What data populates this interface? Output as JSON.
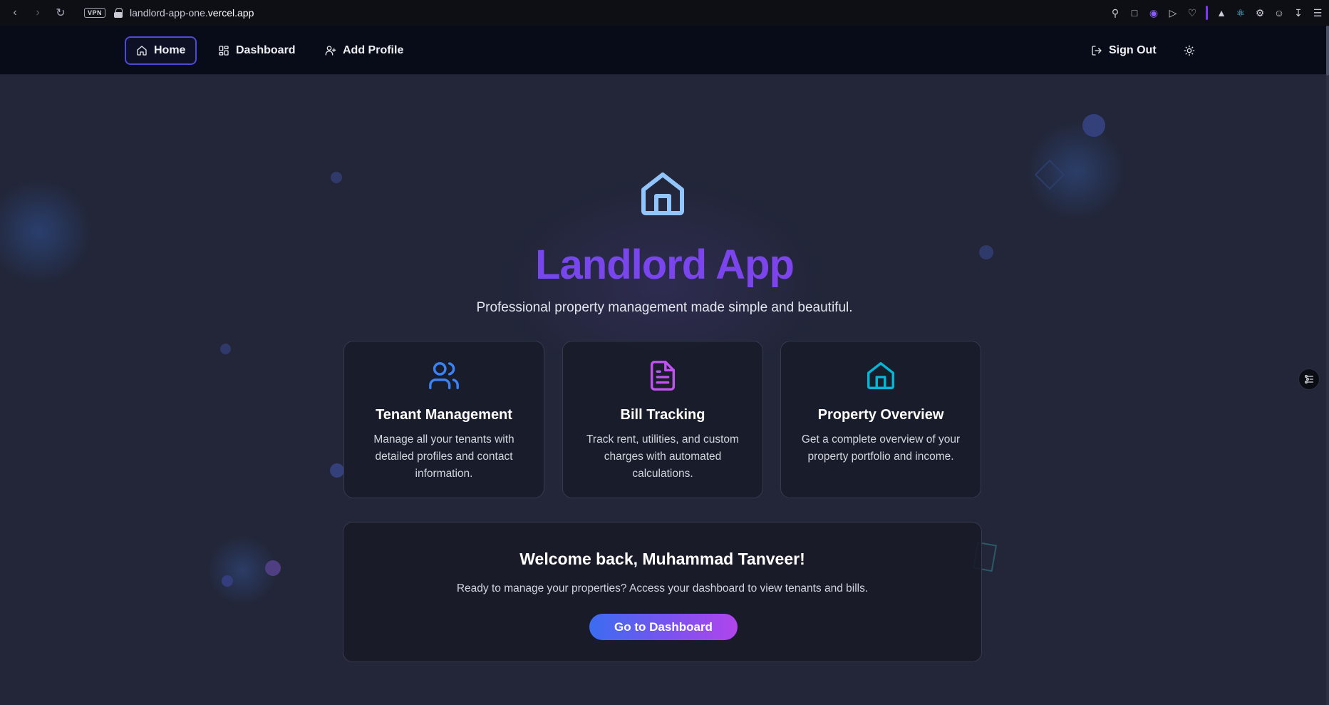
{
  "browser": {
    "vpn_label": "VPN",
    "url_prefix": "landlord-app-one.",
    "url_host": "vercel.app"
  },
  "nav": {
    "home": "Home",
    "dashboard": "Dashboard",
    "add_profile": "Add Profile",
    "sign_out": "Sign Out"
  },
  "hero": {
    "title": "Landlord App",
    "subtitle": "Professional property management made simple and beautiful."
  },
  "features": [
    {
      "icon": "users-icon",
      "title": "Tenant Management",
      "description": "Manage all your tenants with detailed profiles and contact information."
    },
    {
      "icon": "file-text-icon",
      "title": "Bill Tracking",
      "description": "Track rent, utilities, and custom charges with automated calculations."
    },
    {
      "icon": "house-icon",
      "title": "Property Overview",
      "description": "Get a complete overview of your property portfolio and income."
    }
  ],
  "welcome": {
    "title": "Welcome back, Muhammad Tanveer!",
    "text": "Ready to manage your properties? Access your dashboard to view tenants and bills.",
    "button": "Go to Dashboard"
  },
  "colors": {
    "accent_purple": "#7a45ee",
    "users_icon": "#3b82f6",
    "file_icon": "#c052f0",
    "house_icon": "#06b6d4",
    "hero_icon": "#93c5fd"
  }
}
